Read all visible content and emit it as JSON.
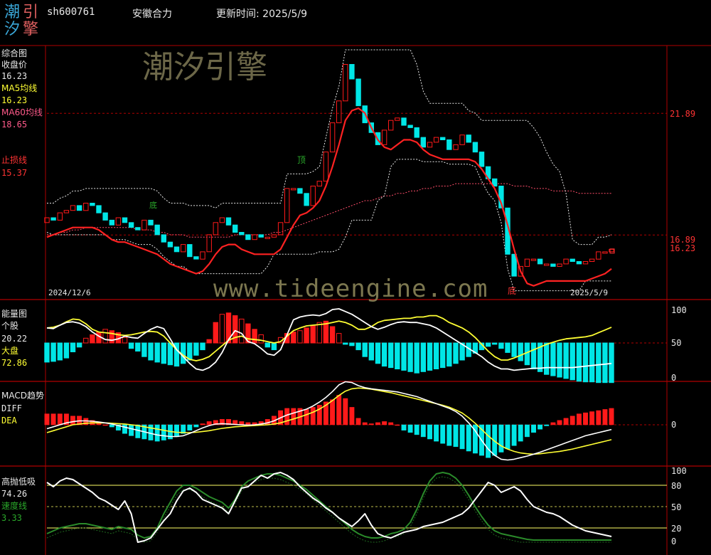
{
  "header": {
    "logo_chars": [
      "潮",
      "引",
      "汐",
      "擎"
    ],
    "code": "sh600761",
    "name": "安徽合力",
    "updated": "更新时间: 2025/5/9"
  },
  "colors": {
    "up": "#ff1a1a",
    "down": "#00e6e6",
    "grid": "#b00000",
    "ma5": "#ffff33",
    "ma60": "#ff4d4d",
    "green": "#2a8a2a"
  },
  "watermarks": {
    "cn": "潮汐引擎",
    "url": "www.tideengine.com"
  },
  "main": {
    "title": "综合图",
    "close_label": "收盘价",
    "close_value": "16.23",
    "ma5_label": "MA5均线",
    "ma5_value": "16.23",
    "ma60_label": "MA60均线",
    "ma60_value": "18.65",
    "stop_label": "止损线",
    "stop_value": "15.37",
    "date_start": "2024/12/6",
    "date_end": "2025/5/9",
    "axis_top": "21.89",
    "axis_mid": "16.23",
    "axis_mid2": "16.89",
    "mark_top": "顶",
    "mark_bottom": "底",
    "mark_left": "底"
  },
  "energy": {
    "title": "能量图",
    "stock_label": "个股",
    "stock_value": "20.22",
    "market_label": "大盘",
    "market_value": "72.86",
    "ticks": [
      "100",
      "50",
      "0"
    ]
  },
  "macd": {
    "title": "MACD趋势",
    "diff_label": "DIFF",
    "dea_label": "DEA",
    "ticks": [
      "0"
    ]
  },
  "hl": {
    "title": "高抛低吸",
    "value": "74.26",
    "speed_label": "速度线",
    "speed_value": "3.33",
    "ticks": [
      "100",
      "80",
      "50",
      "20",
      "0"
    ]
  },
  "chart_data": [
    {
      "type": "candlestick",
      "title": "综合图",
      "x_start": "2024/12/6",
      "x_end": "2025/5/9",
      "ylim": [
        14.5,
        24.5
      ],
      "y_ticks": [
        21.89,
        16.89
      ],
      "last_close": 16.23,
      "ma5": 16.23,
      "ma60": 18.65,
      "stop_loss": 15.37,
      "close": [
        17.6,
        17.5,
        17.8,
        17.9,
        18.1,
        17.9,
        18.2,
        18.1,
        17.8,
        17.5,
        17.3,
        17.6,
        17.4,
        17.2,
        17.1,
        17.5,
        17.3,
        16.9,
        16.6,
        16.4,
        16.2,
        16.5,
        16.0,
        15.9,
        16.2,
        16.9,
        17.4,
        17.6,
        17.3,
        17.0,
        16.9,
        16.7,
        16.9,
        16.8,
        16.8,
        16.9,
        17.4,
        18.8,
        18.8,
        18.6,
        18.1,
        18.9,
        19.1,
        20.3,
        21.5,
        22.4,
        23.9,
        23.3,
        22.2,
        21.5,
        21.1,
        20.6,
        21.2,
        21.6,
        21.7,
        21.4,
        21.3,
        20.9,
        20.5,
        20.7,
        20.9,
        20.8,
        20.4,
        20.6,
        21.0,
        20.7,
        20.3,
        19.7,
        19.2,
        18.9,
        18.0,
        16.1,
        15.2,
        15.6,
        15.9,
        15.9,
        15.7,
        15.7,
        15.6,
        15.7,
        15.9,
        15.8,
        15.7,
        15.8,
        15.9,
        16.2,
        16.2,
        16.3
      ],
      "ma5_series": [
        17.5,
        17.6,
        17.7,
        17.8,
        17.9,
        17.9,
        17.9,
        17.9,
        17.8,
        17.6,
        17.4,
        17.3,
        17.3,
        17.2,
        17.1,
        17.0,
        16.9,
        16.8,
        16.6,
        16.4,
        16.3,
        16.2,
        16.1,
        16.0,
        16.1,
        16.4,
        16.8,
        17.1,
        17.2,
        17.2,
        17.0,
        16.9,
        16.8,
        16.8,
        16.8,
        16.8,
        17.0,
        17.5,
        18.0,
        18.4,
        18.5,
        18.7,
        19.0,
        19.6,
        20.4,
        21.3,
        22.3,
        22.7,
        22.8,
        22.6,
        22.0,
        21.5,
        21.2,
        21.1,
        21.3,
        21.5,
        21.5,
        21.4,
        21.1,
        20.9,
        20.8,
        20.7,
        20.7,
        20.7,
        20.7,
        20.7,
        20.6,
        20.3,
        19.9,
        19.5,
        18.9,
        18.0,
        17.0,
        16.1,
        15.6,
        15.5,
        15.6,
        15.7,
        15.7,
        15.7,
        15.7,
        15.7,
        15.7,
        15.7,
        15.8,
        15.9,
        16.0,
        16.2
      ],
      "ma60_series": [
        16.9,
        16.9,
        17.0,
        17.0,
        17.1,
        17.1,
        17.2,
        17.2,
        17.2,
        17.2,
        17.2,
        17.2,
        17.2,
        17.2,
        17.1,
        17.1,
        17.1,
        17.0,
        17.0,
        16.9,
        16.9,
        16.9,
        16.8,
        16.8,
        16.8,
        16.8,
        16.8,
        16.8,
        16.8,
        16.9,
        16.9,
        16.9,
        16.9,
        16.9,
        16.9,
        17.0,
        17.0,
        17.1,
        17.2,
        17.3,
        17.4,
        17.5,
        17.6,
        17.7,
        17.8,
        17.9,
        18.0,
        18.1,
        18.2,
        18.3,
        18.3,
        18.4,
        18.5,
        18.5,
        18.6,
        18.6,
        18.7,
        18.7,
        18.8,
        18.8,
        18.9,
        18.9,
        18.9,
        19.0,
        19.0,
        19.0,
        19.0,
        19.0,
        19.0,
        19.0,
        19.0,
        19.0,
        18.9,
        18.9,
        18.9,
        18.8,
        18.8,
        18.8,
        18.7,
        18.7,
        18.7,
        18.7,
        18.6,
        18.6,
        18.6,
        18.6,
        18.6,
        18.6
      ]
    },
    {
      "type": "bar+line",
      "title": "能量图",
      "ylim": [
        0,
        100
      ],
      "stock_value": 20.22,
      "market_value": 72.86,
      "stock_line": [
        72,
        71,
        76,
        80,
        81,
        79,
        74,
        66,
        60,
        55,
        54,
        56,
        60,
        58,
        57,
        64,
        70,
        74,
        71,
        56,
        40,
        30,
        20,
        12,
        10,
        14,
        22,
        36,
        55,
        68,
        64,
        52,
        49,
        42,
        34,
        32,
        40,
        62,
        84,
        88,
        90,
        91,
        90,
        93,
        99,
        100,
        96,
        92,
        86,
        80,
        74,
        70,
        73,
        77,
        80,
        81,
        80,
        80,
        78,
        76,
        72,
        66,
        60,
        54,
        48,
        42,
        36,
        30,
        22,
        16,
        12,
        12,
        10,
        11,
        12,
        13,
        13,
        14,
        14,
        14,
        14,
        14,
        15,
        16,
        17,
        18,
        19,
        20
      ],
      "market_line": [
        72,
        73,
        76,
        81,
        85,
        84,
        78,
        70,
        66,
        65,
        64,
        62,
        61,
        62,
        64,
        66,
        67,
        66,
        60,
        50,
        40,
        32,
        26,
        24,
        26,
        30,
        38,
        46,
        54,
        58,
        60,
        56,
        55,
        54,
        52,
        50,
        52,
        60,
        68,
        72,
        75,
        76,
        77,
        78,
        80,
        82,
        80,
        76,
        70,
        70,
        74,
        80,
        83,
        84,
        85,
        86,
        86,
        88,
        88,
        90,
        90,
        86,
        80,
        76,
        72,
        66,
        58,
        48,
        38,
        30,
        25,
        25,
        28,
        32,
        36,
        40,
        44,
        48,
        51,
        54,
        56,
        57,
        58,
        59,
        61,
        65,
        69,
        73
      ],
      "bars": [
        -28,
        -27,
        -25,
        -22,
        -13,
        -6,
        7,
        12,
        16,
        20,
        18,
        15,
        8,
        -8,
        -12,
        -20,
        -25,
        -28,
        -30,
        -32,
        -34,
        -30,
        -25,
        -18,
        -10,
        5,
        30,
        42,
        44,
        40,
        35,
        28,
        20,
        12,
        -6,
        -10,
        8,
        14,
        16,
        18,
        22,
        26,
        30,
        32,
        24,
        14,
        -2,
        -4,
        -10,
        -20,
        -25,
        -30,
        -34,
        -36,
        -38,
        -40,
        -42,
        -44,
        -42,
        -40,
        -38,
        -36,
        -34,
        -30,
        -25,
        -20,
        -15,
        -10,
        -5,
        -2,
        -8,
        -14,
        -20,
        -26,
        -32,
        -38,
        -42,
        -46,
        -48,
        -50,
        -52,
        -54,
        -56,
        -57,
        -57,
        -58,
        -58,
        -58
      ]
    },
    {
      "type": "bar+line",
      "title": "MACD趋势",
      "zero_line": 0,
      "diff": [
        -0.1,
        -0.05,
        0.0,
        0.05,
        0.08,
        0.1,
        0.1,
        0.09,
        0.07,
        0.05,
        0.02,
        -0.02,
        -0.06,
        -0.1,
        -0.14,
        -0.18,
        -0.22,
        -0.26,
        -0.28,
        -0.3,
        -0.3,
        -0.28,
        -0.22,
        -0.15,
        -0.08,
        -0.02,
        0.02,
        0.03,
        0.02,
        0.01,
        0.0,
        -0.01,
        0.0,
        0.02,
        0.05,
        0.1,
        0.18,
        0.25,
        0.3,
        0.35,
        0.4,
        0.48,
        0.58,
        0.7,
        0.85,
        1.02,
        1.1,
        1.08,
        1.0,
        0.95,
        0.92,
        0.9,
        0.88,
        0.86,
        0.84,
        0.8,
        0.76,
        0.72,
        0.66,
        0.6,
        0.54,
        0.48,
        0.42,
        0.34,
        0.22,
        0.05,
        -0.15,
        -0.4,
        -0.62,
        -0.78,
        -0.88,
        -0.9,
        -0.88,
        -0.84,
        -0.8,
        -0.75,
        -0.7,
        -0.64,
        -0.58,
        -0.52,
        -0.46,
        -0.4,
        -0.34,
        -0.28,
        -0.24,
        -0.2,
        -0.16,
        -0.12
      ],
      "dea": [
        -0.2,
        -0.15,
        -0.1,
        -0.05,
        0.0,
        0.02,
        0.04,
        0.05,
        0.05,
        0.05,
        0.04,
        0.03,
        0.02,
        0.0,
        -0.02,
        -0.05,
        -0.08,
        -0.11,
        -0.14,
        -0.17,
        -0.19,
        -0.2,
        -0.2,
        -0.19,
        -0.17,
        -0.15,
        -0.12,
        -0.09,
        -0.07,
        -0.05,
        -0.04,
        -0.03,
        -0.02,
        -0.01,
        0.0,
        0.02,
        0.05,
        0.1,
        0.15,
        0.2,
        0.26,
        0.32,
        0.4,
        0.5,
        0.62,
        0.75,
        0.86,
        0.92,
        0.94,
        0.93,
        0.91,
        0.88,
        0.85,
        0.82,
        0.78,
        0.74,
        0.7,
        0.66,
        0.62,
        0.58,
        0.54,
        0.5,
        0.45,
        0.38,
        0.3,
        0.18,
        0.04,
        -0.12,
        -0.28,
        -0.42,
        -0.54,
        -0.62,
        -0.68,
        -0.72,
        -0.74,
        -0.75,
        -0.74,
        -0.72,
        -0.7,
        -0.68,
        -0.65,
        -0.62,
        -0.58,
        -0.54,
        -0.5,
        -0.46,
        -0.42,
        -0.38
      ],
      "bars": [
        0.2,
        0.2,
        0.2,
        0.2,
        0.16,
        0.16,
        0.12,
        0.08,
        0.04,
        0.0,
        -0.04,
        -0.1,
        -0.16,
        -0.2,
        -0.24,
        -0.26,
        -0.28,
        -0.3,
        -0.28,
        -0.26,
        -0.22,
        -0.16,
        -0.1,
        -0.04,
        0.02,
        0.06,
        0.08,
        0.1,
        0.1,
        0.08,
        0.06,
        0.04,
        0.04,
        0.06,
        0.1,
        0.16,
        0.26,
        0.3,
        0.3,
        0.3,
        0.28,
        0.32,
        0.36,
        0.42,
        0.46,
        0.54,
        0.48,
        0.32,
        0.12,
        0.04,
        0.02,
        0.04,
        0.06,
        0.04,
        0.0,
        -0.1,
        -0.14,
        -0.18,
        -0.22,
        -0.26,
        -0.3,
        -0.34,
        -0.38,
        -0.4,
        -0.44,
        -0.48,
        -0.52,
        -0.56,
        -0.6,
        -0.56,
        -0.5,
        -0.44,
        -0.38,
        -0.3,
        -0.22,
        -0.14,
        -0.08,
        -0.02,
        0.04,
        0.08,
        0.12,
        0.16,
        0.2,
        0.22,
        0.24,
        0.26,
        0.28,
        0.3
      ]
    },
    {
      "type": "line",
      "title": "高抛低吸",
      "ylim": [
        0,
        100
      ],
      "reference_lines": [
        80,
        50,
        20
      ],
      "value": 74.26,
      "speed": 3.33,
      "main_line": [
        84,
        78,
        86,
        90,
        88,
        82,
        76,
        70,
        62,
        58,
        52,
        46,
        58,
        40,
        0,
        2,
        6,
        18,
        30,
        40,
        58,
        72,
        76,
        70,
        60,
        56,
        52,
        48,
        40,
        58,
        76,
        78,
        86,
        94,
        90,
        96,
        98,
        94,
        88,
        78,
        70,
        62,
        56,
        48,
        42,
        34,
        28,
        22,
        30,
        40,
        24,
        12,
        8,
        6,
        10,
        14,
        16,
        18,
        22,
        24,
        26,
        28,
        32,
        36,
        40,
        48,
        60,
        72,
        84,
        80,
        70,
        74,
        78,
        72,
        60,
        50,
        46,
        42,
        40,
        36,
        30,
        24,
        20,
        16,
        14,
        12,
        10,
        8
      ],
      "speed_line": [
        12,
        16,
        20,
        22,
        24,
        26,
        26,
        24,
        22,
        20,
        18,
        22,
        20,
        18,
        10,
        6,
        8,
        20,
        40,
        56,
        72,
        80,
        80,
        76,
        70,
        64,
        60,
        56,
        48,
        60,
        78,
        86,
        90,
        94,
        96,
        96,
        94,
        90,
        86,
        80,
        74,
        66,
        58,
        50,
        42,
        34,
        26,
        18,
        12,
        8,
        6,
        6,
        8,
        12,
        14,
        18,
        28,
        46,
        68,
        86,
        96,
        98,
        96,
        90,
        80,
        66,
        50,
        36,
        24,
        16,
        12,
        10,
        8,
        6,
        4,
        3,
        3,
        3,
        3,
        3,
        3,
        3,
        3,
        3,
        3,
        3,
        3,
        3
      ]
    }
  ]
}
